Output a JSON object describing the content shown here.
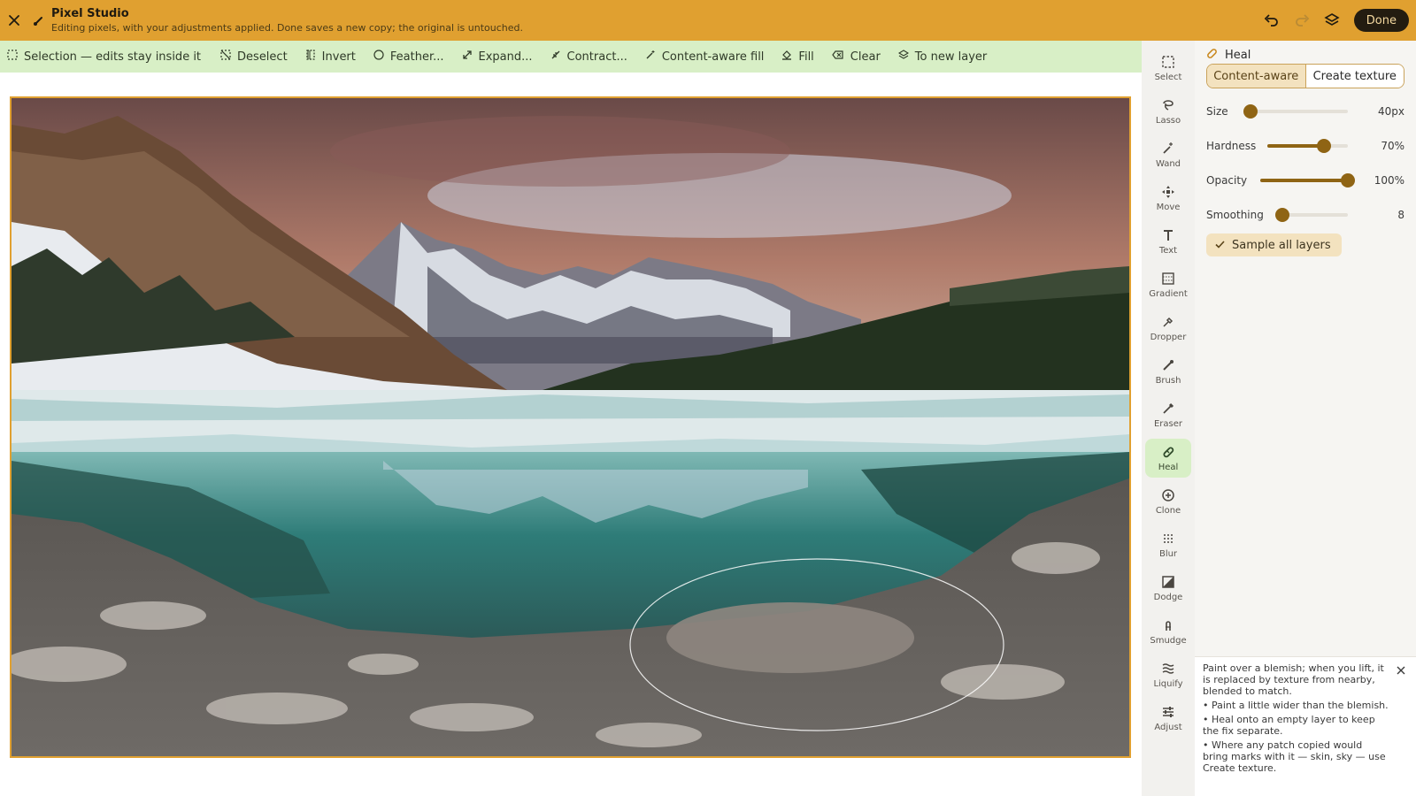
{
  "app": {
    "title": "Pixel Studio",
    "subtitle": "Editing pixels, with your adjustments applied. Done saves a new copy; the original is untouched.",
    "done_label": "Done"
  },
  "selection_bar": {
    "items": [
      {
        "label": "Selection — edits stay inside it",
        "icon": "selection-icon"
      },
      {
        "label": "Deselect",
        "icon": "deselect-icon"
      },
      {
        "label": "Invert",
        "icon": "invert-icon"
      },
      {
        "label": "Feather...",
        "icon": "feather-icon"
      },
      {
        "label": "Expand...",
        "icon": "expand-icon"
      },
      {
        "label": "Contract...",
        "icon": "contract-icon"
      },
      {
        "label": "Content-aware fill",
        "icon": "magic-icon"
      },
      {
        "label": "Fill",
        "icon": "bucket-icon"
      },
      {
        "label": "Clear",
        "icon": "clear-icon"
      },
      {
        "label": "To new layer",
        "icon": "layers-icon"
      }
    ]
  },
  "tools": [
    {
      "label": "Select",
      "icon": "select-icon"
    },
    {
      "label": "Lasso",
      "icon": "lasso-icon"
    },
    {
      "label": "Wand",
      "icon": "wand-icon"
    },
    {
      "label": "Move",
      "icon": "move-icon"
    },
    {
      "label": "Text",
      "icon": "text-icon"
    },
    {
      "label": "Gradient",
      "icon": "gradient-icon"
    },
    {
      "label": "Dropper",
      "icon": "dropper-icon"
    },
    {
      "label": "Brush",
      "icon": "brush-icon"
    },
    {
      "label": "Eraser",
      "icon": "eraser-icon"
    },
    {
      "label": "Heal",
      "icon": "heal-icon",
      "active": true
    },
    {
      "label": "Clone",
      "icon": "clone-icon"
    },
    {
      "label": "Blur",
      "icon": "blur-icon"
    },
    {
      "label": "Dodge",
      "icon": "dodge-icon"
    },
    {
      "label": "Smudge",
      "icon": "smudge-icon"
    },
    {
      "label": "Liquify",
      "icon": "liquify-icon"
    },
    {
      "label": "Adjust",
      "icon": "adjust-icon"
    }
  ],
  "panel": {
    "title": "Heal",
    "modes": [
      "Content-aware",
      "Create texture"
    ],
    "active_mode": "Content-aware",
    "sliders": [
      {
        "label": "Size",
        "value_text": "40px",
        "fraction": 0.0
      },
      {
        "label": "Hardness",
        "value_text": "70%",
        "fraction": 0.7
      },
      {
        "label": "Opacity",
        "value_text": "100%",
        "fraction": 1.0
      },
      {
        "label": "Smoothing",
        "value_text": "8",
        "fraction": 0.08
      }
    ],
    "sample_all_layers": {
      "label": "Sample all layers",
      "checked": true
    }
  },
  "tip": {
    "intro": "Paint over a blemish; when you lift, it is replaced by texture from nearby, blended to match.",
    "bullets": [
      "• Paint a little wider than the blemish.",
      "• Heal onto an empty layer to keep the fix separate.",
      "• Where any patch copied would bring marks with it — skin, sky — use Create texture."
    ]
  },
  "colors": {
    "accent": "#e0a030",
    "selection_bar": "#d8efc6",
    "slider": "#8f6414",
    "done_bg": "#231c10"
  }
}
